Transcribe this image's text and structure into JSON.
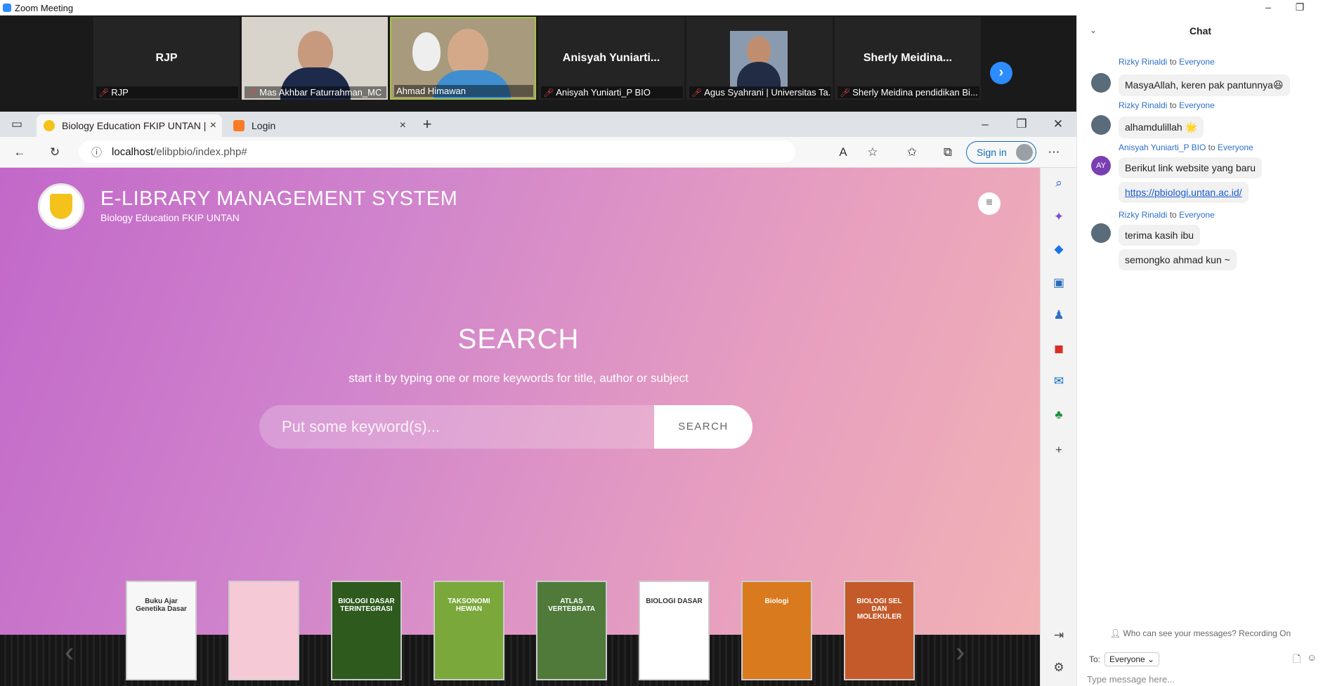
{
  "zoom": {
    "window_title": "Zoom Meeting",
    "minimize": "–",
    "restore": "❐",
    "participants": [
      {
        "name": "RJP",
        "label": "RJP",
        "has_video": false
      },
      {
        "name": "",
        "label": "Mas Akhbar Faturrahman_MC",
        "has_video": true
      },
      {
        "name": "",
        "label": "Ahmad Himawan",
        "has_video": true
      },
      {
        "name": "Anisyah Yuniarti...",
        "label": "Anisyah Yuniarti_P BIO",
        "has_video": false
      },
      {
        "name": "",
        "label": "Agus Syahrani | Universitas Ta...",
        "has_video": true
      },
      {
        "name": "Sherly Meidina...",
        "label": "Sherly Meidina pendidikan Bi...",
        "has_video": false
      }
    ],
    "next_icon": "›"
  },
  "browser": {
    "tabs": [
      {
        "title": "Biology Education FKIP UNTAN |",
        "active": true
      },
      {
        "title": "Login",
        "active": false
      }
    ],
    "new_tab": "+",
    "close_tab": "×",
    "url_host": "localhost",
    "url_path": "/elibpbio/index.php#",
    "sign_in": "Sign in",
    "window_controls": {
      "minimize": "–",
      "restore": "❐",
      "close": "✕"
    }
  },
  "site": {
    "title": "E-LIBRARY MANAGEMENT SYSTEM",
    "subtitle": "Biology Education FKIP UNTAN",
    "search_heading": "SEARCH",
    "search_hint": "start it by typing one or more keywords for title, author or subject",
    "search_placeholder": "Put some keyword(s)...",
    "search_button": "SEARCH",
    "books": [
      {
        "title": "Buku Ajar Genetika Dasar",
        "color": "#f7f7f7",
        "text": "#333"
      },
      {
        "title": "",
        "color": "#f6c9d6",
        "text": "#fff"
      },
      {
        "title": "BIOLOGI DASAR TERINTEGRASI",
        "color": "#2e5a1e",
        "text": "#fff"
      },
      {
        "title": "TAKSONOMI HEWAN",
        "color": "#7ba83a",
        "text": "#fff"
      },
      {
        "title": "ATLAS VERTEBRATA",
        "color": "#4f7a3a",
        "text": "#fff"
      },
      {
        "title": "BIOLOGI DASAR",
        "color": "#ffffff",
        "text": "#333"
      },
      {
        "title": "Biologi",
        "color": "#d97a1e",
        "text": "#fff"
      },
      {
        "title": "BIOLOGI SEL DAN MOLEKULER",
        "color": "#c45a2a",
        "text": "#fff"
      }
    ]
  },
  "chat": {
    "title": "Chat",
    "messages": [
      {
        "from": "Rizky Rinaldi",
        "to_word": "to",
        "to": "Everyone",
        "lines": [
          "MasyaAllah, keren pak pantunnya😆"
        ],
        "avatar_color": "#5a6b7a",
        "initials": ""
      },
      {
        "from": "Rizky Rinaldi",
        "to_word": "to",
        "to": "Everyone",
        "lines": [
          "alhamdulillah 🌟"
        ],
        "avatar_color": "#5a6b7a",
        "initials": ""
      },
      {
        "from": "Anisyah Yuniarti_P BIO",
        "to_word": "to",
        "to": "Everyone",
        "lines": [
          "Berikut link website yang baru",
          "https://pbiologi.untan.ac.id/"
        ],
        "avatar_color": "#7b3fb5",
        "initials": "AY"
      },
      {
        "from": "Rizky Rinaldi",
        "to_word": "to",
        "to": "Everyone",
        "lines": [
          "terima kasih ibu",
          "semongko ahmad kun ~"
        ],
        "avatar_color": "#5a6b7a",
        "initials": ""
      }
    ],
    "notice": "Who can see your messages? Recording On",
    "to_label": "To:",
    "to_value": "Everyone ⌄",
    "input_placeholder": "Type message here..."
  }
}
